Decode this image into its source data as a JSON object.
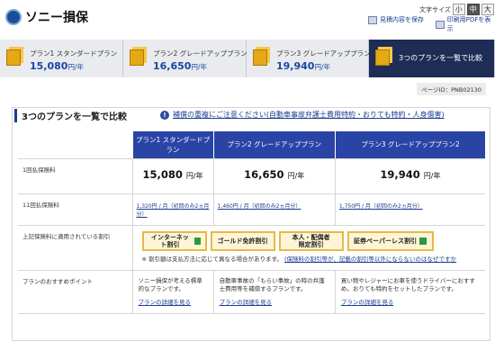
{
  "header": {
    "logo": "ソニー損保",
    "font_size_label": "文字サイズ",
    "font_sizes": [
      "小",
      "中",
      "大"
    ],
    "save_page": "見積内容を保存",
    "print_pdf": "印刷用PDFを表示"
  },
  "tabs": [
    {
      "name": "プラン1 スタンダードプラン",
      "price": "15,080",
      "unit": "円/年"
    },
    {
      "name": "プラン2 グレードアッププラン",
      "price": "16,650",
      "unit": "円/年"
    },
    {
      "name": "プラン3 グレードアッププラン2",
      "price": "19,940",
      "unit": "円/年"
    },
    {
      "name": "3つのプランを一覧で比較"
    }
  ],
  "page_id": "ページID：PNB02130",
  "section": {
    "title": "3つのプランを一覧で比較",
    "notice": "補償の重複にご注意ください(自動車事故弁護士費用特約・おりても特約・人身傷害)"
  },
  "table": {
    "plans": [
      "プラン1 スタンダードプラン",
      "プラン2 グレードアッププラン",
      "プラン3 グレードアッププラン2"
    ],
    "annual_label": "1回払保険料",
    "annual": [
      "15,080",
      "16,650",
      "19,940"
    ],
    "annual_unit": "円/年",
    "monthly_label": "11回払保険料",
    "monthly": [
      "1,320円 / 月（初回のみ2ヵ月分）",
      "1,460円 / 月（初回のみ2ヵ月分）",
      "1,750円 / 月（初回のみ2ヵ月分）"
    ],
    "discount_label": "上記保険料に適用されている割引",
    "discounts": [
      "インターネット割引",
      "ゴールド免許割引",
      "本人・配偶者\n限定割引",
      "証券ペーパーレス割引"
    ],
    "discount_note": "※ 割引額は支払方法に応じて異なる場合があります。",
    "discount_link": "(保険料の割引等が、記載の割引等以外にならないのはなぜですか",
    "rec_label": "プランのおすすめポイント",
    "rec": [
      "ソニー損保が考える標準的なプランです。",
      "自動車事故の「もらい事故」の時の弁護士費用等を補償するプランです。",
      "買い物やレジャーにお車を使うドライバーにおすすめ。おりても特約をセットしたプランです。"
    ],
    "more": "プランの詳細を見る"
  }
}
